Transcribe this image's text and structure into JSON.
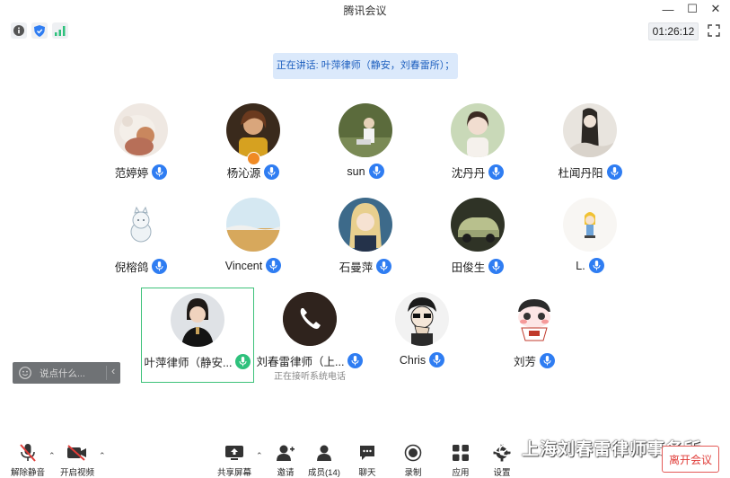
{
  "window": {
    "title": "腾讯会议"
  },
  "topbar": {
    "timer": "01:26:12"
  },
  "speaking": "正在讲话: 叶萍律师（静安，刘春雷所）；",
  "participants": [
    {
      "name": "范婷婷",
      "sub": ""
    },
    {
      "name": "杨沁源",
      "sub": ""
    },
    {
      "name": "sun",
      "sub": ""
    },
    {
      "name": "沈丹丹",
      "sub": ""
    },
    {
      "name": "杜闻丹阳",
      "sub": ""
    },
    {
      "name": "倪榕鸽",
      "sub": ""
    },
    {
      "name": "Vincent",
      "sub": ""
    },
    {
      "name": "石曼萍",
      "sub": ""
    },
    {
      "name": "田俊生",
      "sub": ""
    },
    {
      "name": "L.",
      "sub": ""
    },
    {
      "name": "叶萍律师（静安...",
      "sub": ""
    },
    {
      "name": "刘春雷律师（上...",
      "sub": "正在接听系统电话"
    },
    {
      "name": "Chris",
      "sub": ""
    },
    {
      "name": "刘芳",
      "sub": ""
    }
  ],
  "chat": {
    "placeholder": "说点什么..."
  },
  "toolbar": {
    "unmute": "解除静音",
    "video": "开启视频",
    "share": "共享屏幕",
    "invite": "邀请",
    "members": "成员(14)",
    "chat": "聊天",
    "record": "录制",
    "apps": "应用",
    "settings": "设置",
    "leave": "离开会议"
  },
  "watermark": "上海刘春雷律师事务所",
  "colors": {
    "accent": "#2f7df2",
    "speaking_border": "#3ec27a",
    "leave": "#e03c38"
  }
}
